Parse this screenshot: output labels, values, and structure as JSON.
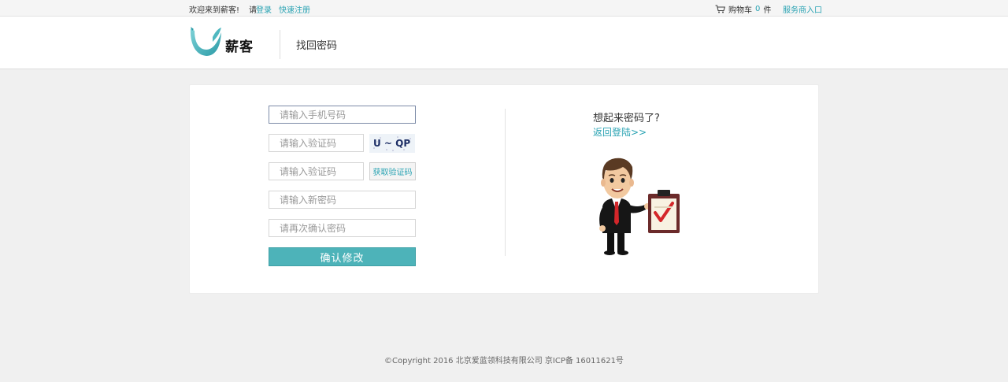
{
  "topbar": {
    "welcome": "欢迎来到薪客!",
    "please": "请",
    "login": "登录",
    "register": "快速注册",
    "cart_prefix": "购物车",
    "cart_count": "0",
    "cart_suffix": "件",
    "provider_entry": "服务商入口",
    "accent": "#2aa3b3"
  },
  "header": {
    "brand": "薪客",
    "page_title": "找回密码"
  },
  "form": {
    "phone_placeholder": "请输入手机号码",
    "captcha_placeholder": "请输入验证码",
    "captcha_text": "U ~ QP",
    "sms_placeholder": "请输入验证码",
    "sms_button": "获取验证码",
    "new_password_placeholder": "请输入新密码",
    "confirm_password_placeholder": "请再次确认密码",
    "submit": "确认修改",
    "submit_color": "#4db3b9"
  },
  "side": {
    "remember": "想起来密码了?",
    "back_login": "返回登陆>>"
  },
  "footer": {
    "copyright": "©Copyright 2016 北京爱蓝领科技有限公司 京ICP备 16011621号"
  }
}
